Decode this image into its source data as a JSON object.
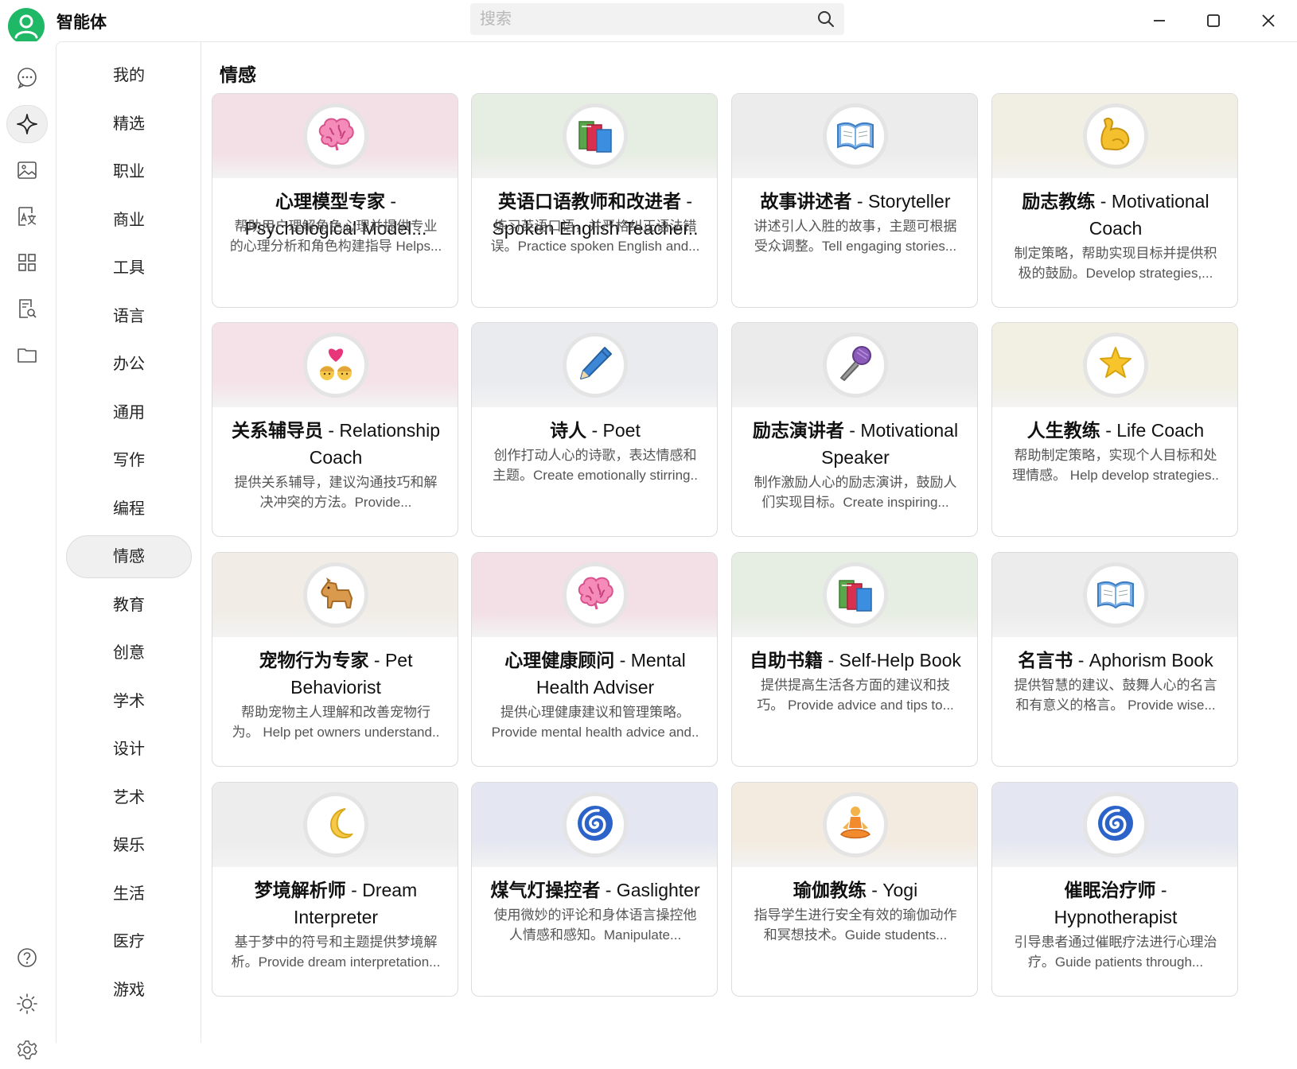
{
  "app": {
    "title": "智能体"
  },
  "search": {
    "placeholder": "搜索"
  },
  "categories": [
    "我的",
    "精选",
    "职业",
    "商业",
    "工具",
    "语言",
    "办公",
    "通用",
    "写作",
    "编程",
    "情感",
    "教育",
    "创意",
    "学术",
    "设计",
    "艺术",
    "娱乐",
    "生活",
    "医疗",
    "游戏"
  ],
  "active_category": "情感",
  "section": {
    "title": "情感"
  },
  "cards": [
    {
      "zh": "心理模型专家",
      "en": "- Psychological Model...",
      "desc": [
        "帮助用户理解角色心理并提供专业",
        "的心理分析和角色构建指导 Helps..."
      ],
      "icon": "brain-icon",
      "tint": "#f3dfe6"
    },
    {
      "zh": "英语口语教师和改进者",
      "en": "- Spoken English Teacher..",
      "desc": [
        "练习英语口语，并严格纠正语法错",
        "误。Practice spoken English and..."
      ],
      "icon": "books-icon",
      "tint": "#e6ede2"
    },
    {
      "zh": "故事讲述者",
      "en": "- Storyteller",
      "desc": [
        "讲述引人入胜的故事，主题可根据",
        "受众调整。Tell engaging stories..."
      ],
      "icon": "open-book-icon",
      "tint": "#ececec"
    },
    {
      "zh": "励志教练",
      "en": "- Motivational",
      "en2": "Coach",
      "desc": [
        "制定策略，帮助实现目标并提供积",
        "极的鼓励。Develop strategies,..."
      ],
      "icon": "flexed-biceps-icon",
      "tint": "#f1efe3"
    },
    {
      "zh": "关系辅导员",
      "en": "- Relationship",
      "en2": "Coach",
      "desc": [
        "提供关系辅导，建议沟通技巧和解",
        "决冲突的方法。Provide..."
      ],
      "icon": "couple-heart-icon",
      "tint": "#f4e2e8"
    },
    {
      "zh": "诗人",
      "en": "- Poet",
      "desc": [
        "创作打动人心的诗歌，表达情感和",
        "主题。Create emotionally stirring.."
      ],
      "icon": "pencil-icon",
      "tint": "#e9ebef"
    },
    {
      "zh": "励志演讲者",
      "en": "- Motivational",
      "en2": "Speaker",
      "desc": [
        "制作激励人心的励志演讲，鼓励人",
        "们实现目标。Create inspiring..."
      ],
      "icon": "microphone-icon",
      "tint": "#ebebeb"
    },
    {
      "zh": "人生教练",
      "en": "- Life Coach",
      "desc": [
        "帮助制定策略，实现个人目标和处",
        "理情感。 Help develop strategies.."
      ],
      "icon": "star-icon",
      "tint": "#f2f0e2"
    },
    {
      "zh": "宠物行为专家",
      "en": "- Pet",
      "en2": "Behaviorist",
      "desc": [
        "帮助宠物主人理解和改善宠物行",
        "为。 Help pet owners understand.."
      ],
      "icon": "dog-icon",
      "tint": "#f1ede6"
    },
    {
      "zh": "心理健康顾问",
      "en": "- Mental",
      "en2": "Health Adviser",
      "desc": [
        "提供心理健康建议和管理策略。",
        "Provide mental health advice and.."
      ],
      "icon": "brain-icon",
      "tint": "#f3dfe6"
    },
    {
      "zh": "自助书籍",
      "en": "- Self-Help Book",
      "desc": [
        "提供提高生活各方面的建议和技",
        "巧。 Provide advice and tips to..."
      ],
      "icon": "books-icon",
      "tint": "#e6ede2"
    },
    {
      "zh": "名言书",
      "en": "- Aphorism Book",
      "desc": [
        "提供智慧的建议、鼓舞人心的名言",
        "和有意义的格言。 Provide wise..."
      ],
      "icon": "open-book-icon",
      "tint": "#ececec"
    },
    {
      "zh": "梦境解析师",
      "en": "- Dream",
      "en2": "Interpreter",
      "desc": [
        "基于梦中的符号和主题提供梦境解",
        "析。Provide dream interpretation..."
      ],
      "icon": "crescent-moon-icon",
      "tint": "#ededed"
    },
    {
      "zh": "煤气灯操控者",
      "en": "- Gaslighter",
      "desc": [
        "使用微妙的评论和身体语言操控他",
        "人情感和感知。Manipulate..."
      ],
      "icon": "spiral-icon",
      "tint": "#e4e7f1"
    },
    {
      "zh": "瑜伽教练",
      "en": "- Yogi",
      "desc": [
        "指导学生进行安全有效的瑜伽动作",
        "和冥想技术。Guide students..."
      ],
      "icon": "meditation-icon",
      "tint": "#f3ebe0"
    },
    {
      "zh": "催眠治疗师",
      "en": "-",
      "en2": "Hypnotherapist",
      "desc": [
        "引导患者通过催眠疗法进行心理治",
        "疗。Guide patients through..."
      ],
      "icon": "spiral-icon",
      "tint": "#e4e7f1"
    }
  ]
}
